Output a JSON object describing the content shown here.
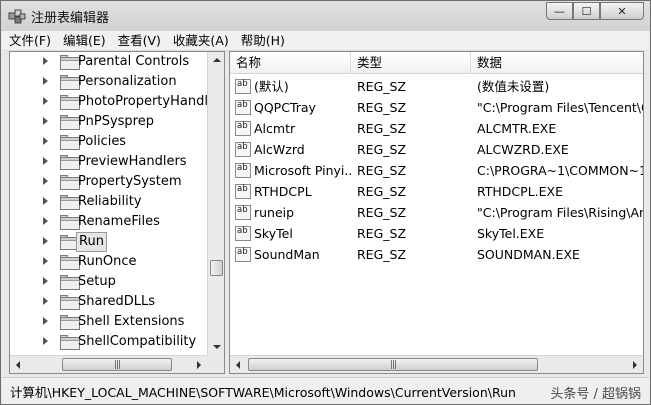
{
  "window": {
    "title": "注册表编辑器",
    "controls": {
      "minimize": "—",
      "maximize": "☐",
      "close": "✕"
    }
  },
  "menu": [
    {
      "label": "文件(F)"
    },
    {
      "label": "编辑(E)"
    },
    {
      "label": "查看(V)"
    },
    {
      "label": "收藏夹(A)"
    },
    {
      "label": "帮助(H)"
    }
  ],
  "tree": {
    "items": [
      {
        "label": "Parental Controls"
      },
      {
        "label": "Personalization"
      },
      {
        "label": "PhotoPropertyHandler"
      },
      {
        "label": "PnPSysprep"
      },
      {
        "label": "Policies"
      },
      {
        "label": "PreviewHandlers"
      },
      {
        "label": "PropertySystem"
      },
      {
        "label": "Reliability"
      },
      {
        "label": "RenameFiles"
      },
      {
        "label": "Run"
      },
      {
        "label": "RunOnce"
      },
      {
        "label": "Setup"
      },
      {
        "label": "SharedDLLs"
      },
      {
        "label": "Shell Extensions"
      },
      {
        "label": "ShellCompatibility"
      }
    ],
    "selected": "Run",
    "scroll_grip": "|||"
  },
  "values": {
    "columns": {
      "name": "名称",
      "type": "类型",
      "data": "数据"
    },
    "icon_text": "ab",
    "rows": [
      {
        "name": "(默认)",
        "type": "REG_SZ",
        "data": "(数值未设置)"
      },
      {
        "name": " QQPCTray",
        "type": "REG_SZ",
        "data": "\"C:\\Program Files\\Tencent\\Q"
      },
      {
        "name": "Alcmtr",
        "type": "REG_SZ",
        "data": "ALCMTR.EXE"
      },
      {
        "name": "AlcWzrd",
        "type": "REG_SZ",
        "data": "ALCWZRD.EXE"
      },
      {
        "name": "Microsoft Pinyi...",
        "type": "REG_SZ",
        "data": "C:\\PROGRA~1\\COMMON~1"
      },
      {
        "name": "RTHDCPL",
        "type": "REG_SZ",
        "data": "RTHDCPL.EXE"
      },
      {
        "name": "runeip",
        "type": "REG_SZ",
        "data": "\"C:\\Program Files\\Rising\\Ant"
      },
      {
        "name": "SkyTel",
        "type": "REG_SZ",
        "data": "SkyTel.EXE"
      },
      {
        "name": "SoundMan",
        "type": "REG_SZ",
        "data": "SOUNDMAN.EXE"
      }
    ]
  },
  "statusbar": {
    "path": "计算机\\HKEY_LOCAL_MACHINE\\SOFTWARE\\Microsoft\\Windows\\CurrentVersion\\Run"
  },
  "watermark": "头条号 / 超锅锅"
}
